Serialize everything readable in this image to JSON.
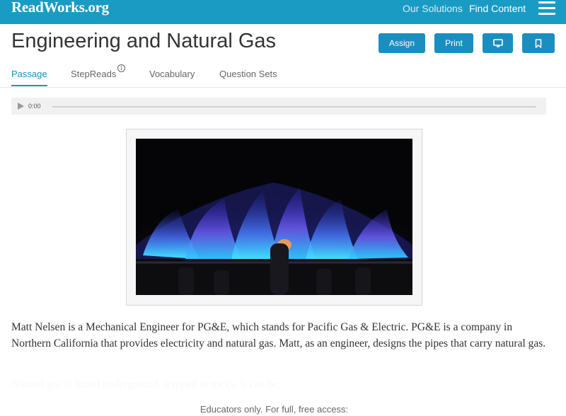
{
  "header": {
    "logo": "ReadWorks.org",
    "nav": [
      {
        "label": "Our Solutions"
      },
      {
        "label": "Find Content"
      }
    ],
    "menu_icon": "hamburger-menu-icon"
  },
  "article": {
    "title": "Engineering and Natural Gas",
    "actions": {
      "assign_label": "Assign",
      "print_label": "Print",
      "present_icon": "monitor-icon",
      "bookmark_icon": "bookmark-icon"
    }
  },
  "tabs": [
    {
      "label": "Passage",
      "active": true
    },
    {
      "label": "StepReads",
      "info_icon": "info-icon",
      "info_glyph": "i"
    },
    {
      "label": "Vocabulary"
    },
    {
      "label": "Question Sets"
    }
  ],
  "audio": {
    "time": "0:00",
    "progress": 0,
    "play_icon": "play-icon"
  },
  "passage": {
    "paragraph_1": "Matt Nelsen is a Mechanical Engineer for PG&E, which stands for Pacific Gas & Electric. PG&E is a company in Northern California that provides electricity and natural gas. Matt, as an engineer, designs the pipes that carry natural gas.",
    "paragraph_2": "Natural gas is found underground, trapped in rocks. It can be..."
  },
  "paywall": {
    "text": "Educators only. For full, free access:"
  },
  "colors": {
    "brand": "#1a9bc4",
    "button": "#1a8fbf",
    "active_tab": "#1a8fbf"
  }
}
